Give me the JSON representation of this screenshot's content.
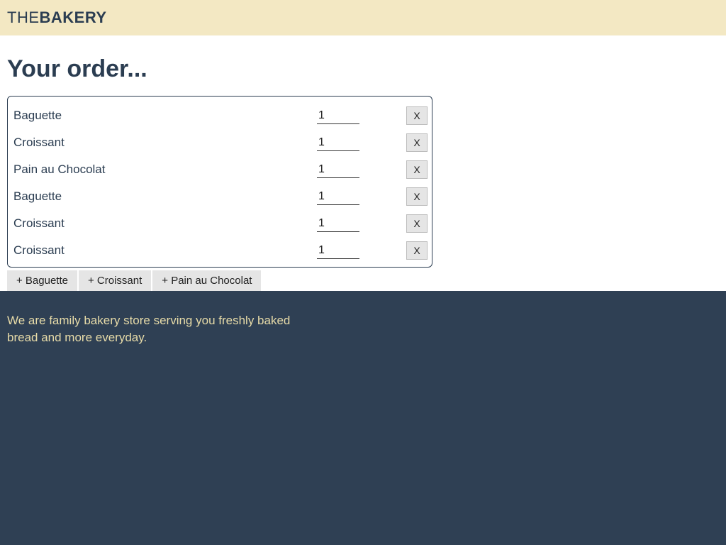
{
  "brand": {
    "prefix": "THE",
    "name": "BAKERY"
  },
  "page": {
    "title": "Your order..."
  },
  "order": {
    "items": [
      {
        "name": "Baguette",
        "qty": "1"
      },
      {
        "name": "Croissant",
        "qty": "1"
      },
      {
        "name": "Pain au Chocolat",
        "qty": "1"
      },
      {
        "name": "Baguette",
        "qty": "1"
      },
      {
        "name": "Croissant",
        "qty": "1"
      },
      {
        "name": "Croissant",
        "qty": "1"
      }
    ],
    "remove_label": "X"
  },
  "add_buttons": [
    {
      "label": "+ Baguette"
    },
    {
      "label": "+ Croissant"
    },
    {
      "label": "+ Pain au Chocolat"
    }
  ],
  "footer": {
    "text": "We are family bakery store serving you freshly baked bread and more everyday."
  }
}
